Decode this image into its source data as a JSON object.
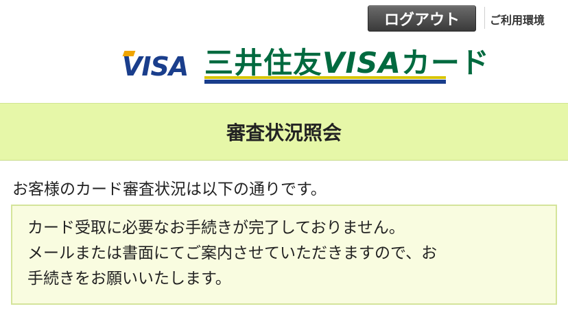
{
  "header": {
    "logout_label": "ログアウト",
    "environment_link": "ご利用環境"
  },
  "logo": {
    "visa_mark": "VISA",
    "name_prefix": "三井住友",
    "name_visa": "VISA",
    "name_suffix": "カード"
  },
  "page": {
    "title": "審査状況照会",
    "intro": "お客様のカード審査状況は以下の通りです。"
  },
  "notice": {
    "lines": [
      "カード受取に必要なお手続きが完了しておりません。",
      "メールまたは書面にてご案内させていただきますので、お",
      "手続きをお願いいたします。"
    ]
  },
  "colors": {
    "title_bar_bg": "#e6f7a8",
    "notice_bg": "#f9fce0",
    "brand_green": "#006a3f",
    "brand_blue": "#1a3e8c",
    "button_dark": "#3a3a3a"
  }
}
